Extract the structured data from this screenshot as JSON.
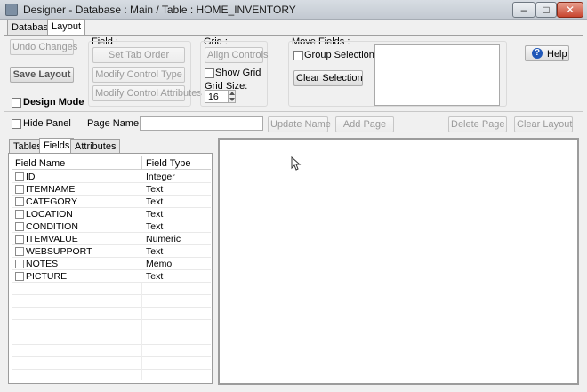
{
  "window": {
    "title": "Designer - Database : Main / Table : HOME_INVENTORY",
    "minimize_glyph": "–",
    "maximize_glyph": "□",
    "close_glyph": "✕"
  },
  "main_tabs": [
    {
      "label": "Database",
      "active": false
    },
    {
      "label": "Layout",
      "active": true
    }
  ],
  "toolbar": {
    "undo_label": "Undo Changes",
    "save_layout_label": "Save Layout",
    "design_mode_label": "Design Mode",
    "field_group": {
      "label": "Field :",
      "set_tab_order": "Set Tab Order",
      "modify_control_type": "Modify Control Type",
      "modify_control_attributes": "Modify Control Attributes"
    },
    "grid_group": {
      "label": "Grid :",
      "align_controls": "Align Controls",
      "show_grid": "Show Grid",
      "grid_size_label": "Grid Size:",
      "grid_size_value": "16"
    },
    "move_fields_group": {
      "label": "Move Fields :",
      "group_selection": "Group Selection",
      "clear_selection": "Clear Selection"
    },
    "help_icon_glyph": "?",
    "help_label": "Help"
  },
  "page_bar": {
    "hide_panel_label": "Hide Panel",
    "page_name_label": "Page Name:",
    "page_name_value": "",
    "update_name": "Update Name",
    "add_page": "Add Page",
    "delete_page": "Delete Page",
    "clear_layout": "Clear Layout"
  },
  "side_tabs": [
    {
      "label": "Tables",
      "active": false
    },
    {
      "label": "Fields",
      "active": true
    },
    {
      "label": "Attributes",
      "active": false
    }
  ],
  "fields_table": {
    "headers": [
      "Field Name",
      "Field Type"
    ],
    "rows": [
      {
        "name": "ID",
        "type": "Integer"
      },
      {
        "name": "ITEMNAME",
        "type": "Text"
      },
      {
        "name": "CATEGORY",
        "type": "Text"
      },
      {
        "name": "LOCATION",
        "type": "Text"
      },
      {
        "name": "CONDITION",
        "type": "Text"
      },
      {
        "name": "ITEMVALUE",
        "type": "Numeric"
      },
      {
        "name": "WEBSUPPORT",
        "type": "Text"
      },
      {
        "name": "NOTES",
        "type": "Memo"
      },
      {
        "name": "PICTURE",
        "type": "Text"
      }
    ]
  },
  "colors": {
    "help_icon": "#1f57b8",
    "window_bg": "#f0f0f0"
  }
}
